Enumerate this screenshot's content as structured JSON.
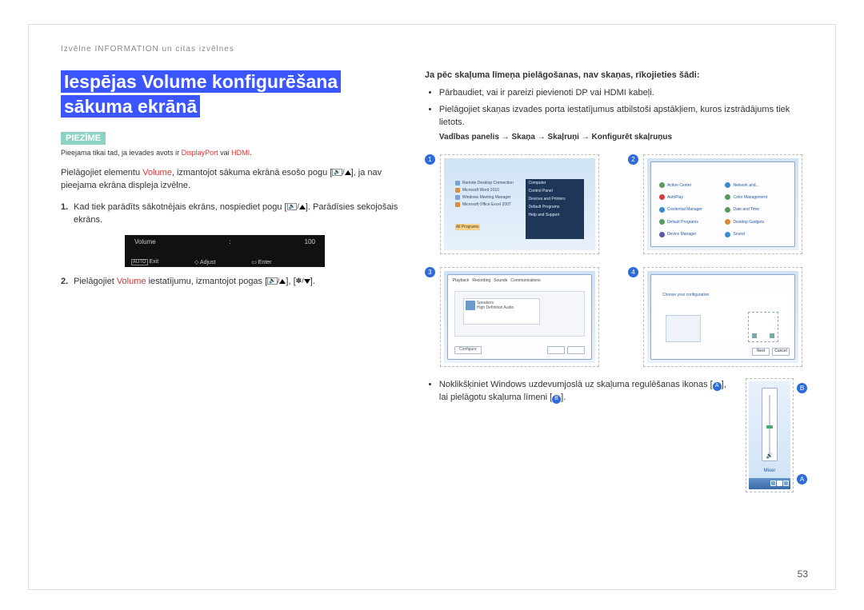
{
  "header": "Izvēlne INFORMATION un citas izvēlnes",
  "title_line1": "Iespējas Volume konfigurēšana",
  "title_line2": "sākuma ekrānā",
  "note_label": "PIEZĪME",
  "note_text_a": "Pieejama tikai tad, ja ievades avots ir ",
  "note_dp": "DisplayPort",
  "note_or": " vai ",
  "note_hdmi": "HDMI",
  "note_dot": ".",
  "body1a": "Pielāgojiet elementu ",
  "body1_vol": "Volume",
  "body1b": ", izmantojot sākuma ekrānā esošo pogu [",
  "body1c": "], ja nav pieejama ekrāna displeja izvēlne.",
  "step1_n": "1.",
  "step1a": "Kad tiek parādīts sākotnējais ekrāns, nospiediet pogu [",
  "step1b": "]. Parādīsies sekojošais ekrāns.",
  "osd_label": "Volume",
  "osd_sep": ":",
  "osd_val": "100",
  "osd_exit": "Exit",
  "osd_adjust": "Adjust",
  "osd_enter": "Enter",
  "step2_n": "2.",
  "step2a": "Pielāgojiet ",
  "step2_vol": "Volume",
  "step2b": " iestatījumu, izmantojot pogas [",
  "step2c": "], [",
  "step2d": "].",
  "right_head": "Ja pēc skaļuma līmeņa pielāgošanas, nav skaņas, rīkojieties šādi:",
  "bullet1": "Pārbaudiet, vai ir pareizi pievienoti DP vai HDMI kabeļi.",
  "bullet2": "Pielāgojiet skaņas izvades porta iestatījumus atbilstoši apstākļiem, kuros izstrādājums tiek lietots.",
  "navpath": "Vadības panelis → Skaņa → Skaļruņi → Konfigurēt skaļruņus",
  "bullet3a": "Noklikšķiniet Windows uzdevumjoslā uz skaļuma regulēšanas ikonas [",
  "bullet3b": "], lai pielāgotu skaļuma līmeni [",
  "bullet3c": "].",
  "markA": "A",
  "markB": "B",
  "circ1": "1",
  "circ2": "2",
  "circ3": "3",
  "circ4": "4",
  "mixer": "Mixer",
  "pagenum": "53",
  "all_programs": "All Programs",
  "choose_config": "Choose your configuration",
  "chart_data": null
}
